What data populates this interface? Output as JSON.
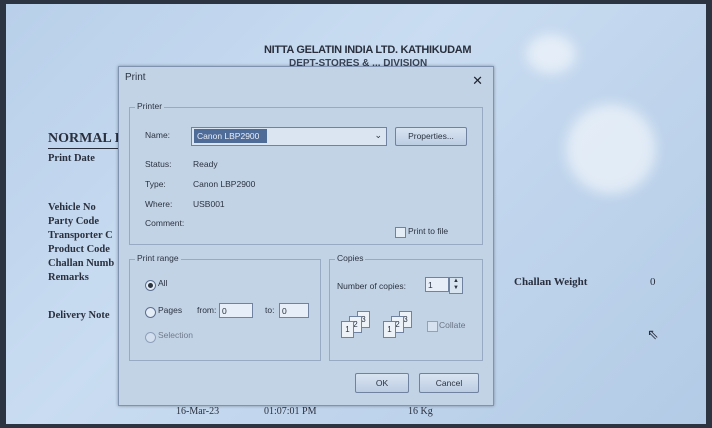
{
  "background_doc": {
    "company": "NITTA GELATIN INDIA LTD. KATHIKUDAM",
    "division": "DEPT-STORES & ... DIVISION",
    "heading": "NORMAL I",
    "labels": [
      "Print Date",
      "Vehicle No",
      "Party Code",
      "Transporter C",
      "Product Code",
      "Challan Numb",
      "Remarks",
      "Delivery Note"
    ],
    "challan_weight_label": "Challan Weight",
    "challan_weight_value": "0",
    "bottom_row": [
      "16-Mar-23",
      "01:07:01 PM",
      "16 Kg"
    ]
  },
  "dialog": {
    "title": "Print",
    "close_glyph": "✕",
    "printer_group": "Printer",
    "name_label": "Name:",
    "name_value": "Canon LBP2900",
    "properties_button": "Properties...",
    "status_label": "Status:",
    "status_value": "Ready",
    "type_label": "Type:",
    "type_value": "Canon LBP2900",
    "where_label": "Where:",
    "where_value": "USB001",
    "comment_label": "Comment:",
    "print_to_file_label": "Print to file",
    "range_group": "Print range",
    "all_label": "All",
    "pages_label": "Pages",
    "from_label": "from:",
    "from_value": "0",
    "to_label": "to:",
    "to_value": "0",
    "selection_label": "Selection",
    "copies_group": "Copies",
    "num_copies_label": "Number of copies:",
    "num_copies_value": "1",
    "collate_label": "Collate",
    "ok_button": "OK",
    "cancel_button": "Cancel"
  }
}
